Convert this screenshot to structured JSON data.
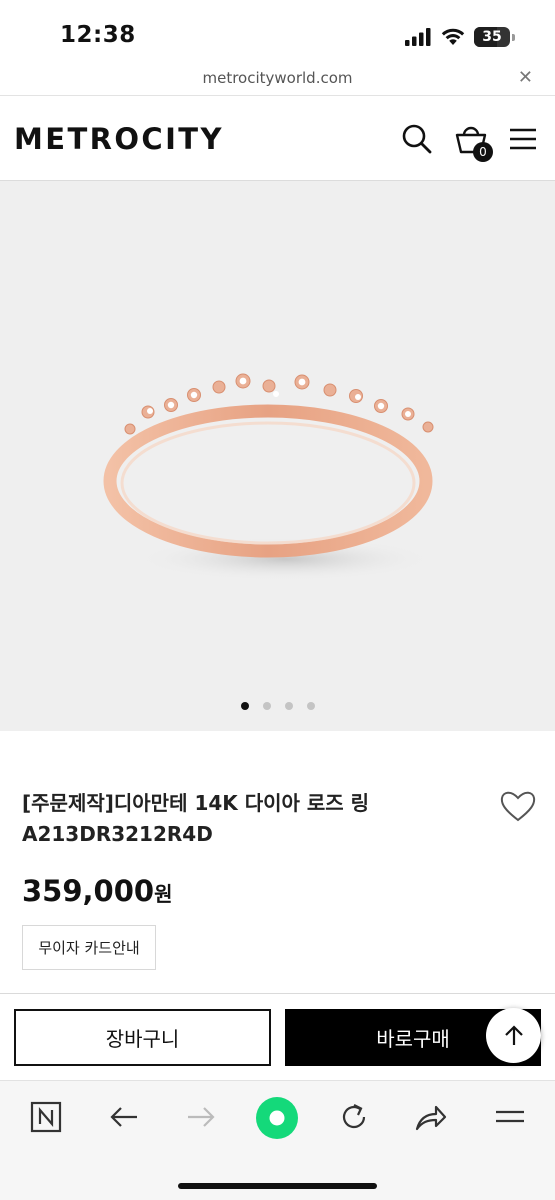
{
  "status": {
    "time": "12:38",
    "battery": "35",
    "icons": [
      "signal-icon",
      "wifi-icon",
      "battery-icon"
    ]
  },
  "browser": {
    "url": "metrocityworld.com",
    "close_glyph": "✕"
  },
  "header": {
    "logo": "METROCITY",
    "icons": [
      "search-icon",
      "cart-icon",
      "menu-icon"
    ],
    "cart_count": "0"
  },
  "gallery": {
    "slide_count": 4,
    "active_index": 0
  },
  "product": {
    "title_line1": "[주문제작]디아만테 14K 다이아 로즈 링",
    "title_line2": "A213DR3212R4D",
    "price": "359,000",
    "price_unit": "원",
    "card_info_label": "무이자 카드안내"
  },
  "actions": {
    "cart_label": "장바구니",
    "buy_label": "바로구매"
  },
  "toolbar": {
    "items": [
      "naver-icon",
      "back-icon",
      "forward-icon",
      "green-dot-icon",
      "reload-icon",
      "share-icon",
      "tabs-menu-icon"
    ]
  },
  "colors": {
    "accent_green": "#14d97a",
    "gallery_bg": "#efefef",
    "rose_gold": "#e9a98c"
  }
}
